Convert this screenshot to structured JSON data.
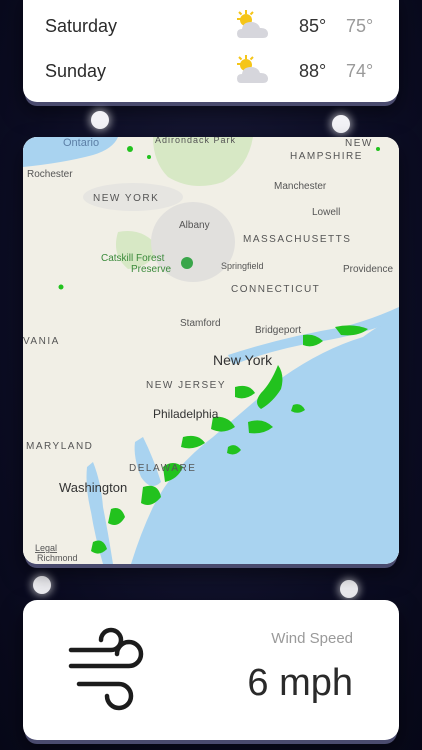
{
  "forecast": [
    {
      "day": "Saturday",
      "high": "85°",
      "low": "75°",
      "icon": "partly-sunny-icon"
    },
    {
      "day": "Sunday",
      "high": "88°",
      "low": "74°",
      "icon": "partly-sunny-icon"
    }
  ],
  "map": {
    "labels": {
      "ontario": "Ontario",
      "adirondack": "Adirondack Park",
      "new_hampshire_1": "NEW",
      "new_hampshire_2": "HAMPSHIRE",
      "rochester": "Rochester",
      "new_york_state": "NEW YORK",
      "manchester": "Manchester",
      "lowell": "Lowell",
      "albany": "Albany",
      "massachusetts": "MASSACHUSETTS",
      "catskill_1": "Catskill Forest",
      "catskill_2": "Preserve",
      "springfield": "Springfield",
      "providence": "Providence",
      "connecticut": "CONNECTICUT",
      "stamford": "Stamford",
      "bridgeport": "Bridgeport",
      "vania": "VANIA",
      "new_york_city": "New York",
      "new_jersey": "NEW JERSEY",
      "philadelphia": "Philadelphia",
      "maryland": "MARYLAND",
      "delaware": "DELAWARE",
      "washington": "Washington",
      "legal": "Legal",
      "richmond": "Richmond"
    }
  },
  "wind": {
    "label": "Wind Speed",
    "value": "6 mph",
    "icon": "wind-icon"
  },
  "colors": {
    "card": "#ffffff",
    "background": "#0b0c22",
    "water": "#a9d3f0",
    "land": "#f1efe6",
    "radar": "#22c21e"
  }
}
